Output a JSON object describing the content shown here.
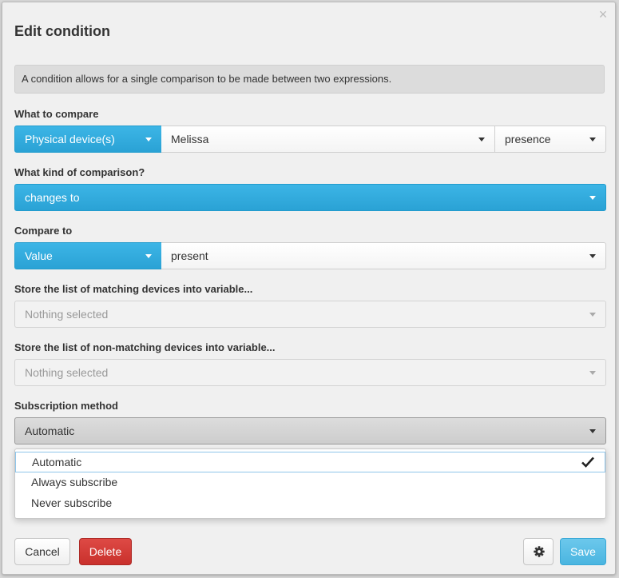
{
  "dialog": {
    "title": "Edit condition",
    "close_glyph": "×",
    "info": "A condition allows for a single comparison to be made between two expressions."
  },
  "what_to_compare": {
    "label": "What to compare",
    "source_type": "Physical device(s)",
    "device": "Melissa",
    "attribute": "presence"
  },
  "comparison": {
    "label": "What kind of comparison?",
    "operator": "changes to"
  },
  "compare_to": {
    "label": "Compare to",
    "type": "Value",
    "value": "present"
  },
  "matching_var": {
    "label": "Store the list of matching devices into variable...",
    "placeholder": "Nothing selected"
  },
  "non_matching_var": {
    "label": "Store the list of non-matching devices into variable...",
    "placeholder": "Nothing selected"
  },
  "subscription": {
    "label": "Subscription method",
    "selected": "Automatic",
    "options": [
      "Automatic",
      "Always subscribe",
      "Never subscribe"
    ]
  },
  "footer": {
    "cancel": "Cancel",
    "delete": "Delete",
    "save": "Save"
  },
  "icons": {
    "close": "close-icon",
    "caret": "caret-down-icon",
    "check": "check-icon",
    "settings": "gear-icon"
  },
  "colors": {
    "primary": "#2aa2d5",
    "danger": "#c9302c",
    "save": "#4ab5e0"
  }
}
